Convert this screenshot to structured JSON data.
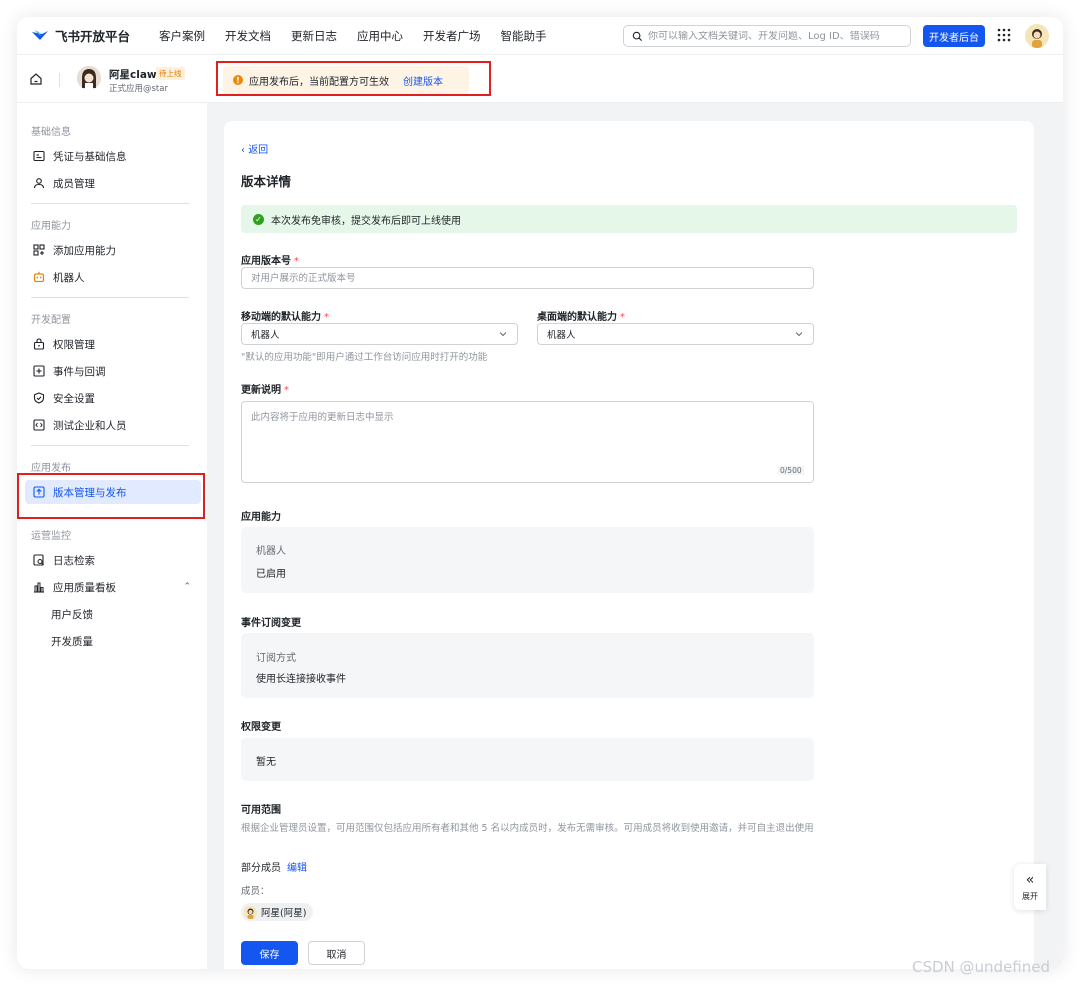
{
  "header": {
    "logo_text": "飞书开放平台",
    "nav": [
      "客户案例",
      "开发文档",
      "更新日志",
      "应用中心",
      "开发者广场",
      "智能助手"
    ],
    "search_placeholder": "你可以输入文档关键词、开发问题、Log ID、错误码",
    "dev_button": "开发者后台"
  },
  "app": {
    "name": "阿星claw",
    "status_tag": "待上线",
    "subtitle": "正式应用@star"
  },
  "notice": {
    "text": "应用发布后，当前配置方可生效",
    "link": "创建版本"
  },
  "sidebar": {
    "sections": [
      {
        "title": "基础信息",
        "items": [
          {
            "label": "凭证与基础信息",
            "icon": "credential-icon"
          },
          {
            "label": "成员管理",
            "icon": "person-icon"
          }
        ]
      },
      {
        "title": "应用能力",
        "items": [
          {
            "label": "添加应用能力",
            "icon": "add-capability-icon"
          },
          {
            "label": "机器人",
            "icon": "robot-icon"
          }
        ]
      },
      {
        "title": "开发配置",
        "items": [
          {
            "label": "权限管理",
            "icon": "lock-icon"
          },
          {
            "label": "事件与回调",
            "icon": "event-icon"
          },
          {
            "label": "安全设置",
            "icon": "shield-icon"
          },
          {
            "label": "测试企业和人员",
            "icon": "test-icon"
          }
        ]
      },
      {
        "title": "应用发布",
        "items": [
          {
            "label": "版本管理与发布",
            "icon": "upload-icon"
          }
        ]
      },
      {
        "title": "运营监控",
        "items": [
          {
            "label": "日志检索",
            "icon": "log-search-icon"
          },
          {
            "label": "应用质量看板",
            "icon": "chart-icon"
          },
          {
            "label": "用户反馈"
          },
          {
            "label": "开发质量"
          }
        ]
      }
    ]
  },
  "main": {
    "back": "返回",
    "title": "版本详情",
    "success_text": "本次发布免审核，提交发布后即可上线使用",
    "version_label": "应用版本号",
    "version_placeholder": "对用户展示的正式版本号",
    "mobile_label": "移动端的默认能力",
    "mobile_value": "机器人",
    "desktop_label": "桌面端的默认能力",
    "desktop_value": "机器人",
    "default_hint": "\"默认的应用功能\"即用户通过工作台访问应用时打开的功能",
    "update_label": "更新说明",
    "update_placeholder": "此内容将于应用的更新日志中显示",
    "update_counter": "0/500",
    "capability_title": "应用能力",
    "capability_name": "机器人",
    "capability_status": "已启用",
    "event_title": "事件订阅变更",
    "event_key": "订阅方式",
    "event_value": "使用长连接接收事件",
    "permission_title": "权限变更",
    "permission_value": "暂无",
    "scope_title": "可用范围",
    "scope_desc": "根据企业管理员设置，可用范围仅包括应用所有者和其他 5 名以内成员时，发布无需审核。可用成员将收到使用邀请，并可自主退出使用",
    "scope_partial": "部分成员",
    "scope_edit": "编辑",
    "members_label": "成员：",
    "member_name": "阿星(阿星)",
    "save": "保存",
    "cancel": "取消"
  },
  "expand_label": "展开",
  "watermark": "CSDN @undefined",
  "colors": {
    "primary": "#1456f0",
    "warning": "#ed8a0c",
    "success": "#2ea121",
    "highlight": "#e02020"
  }
}
